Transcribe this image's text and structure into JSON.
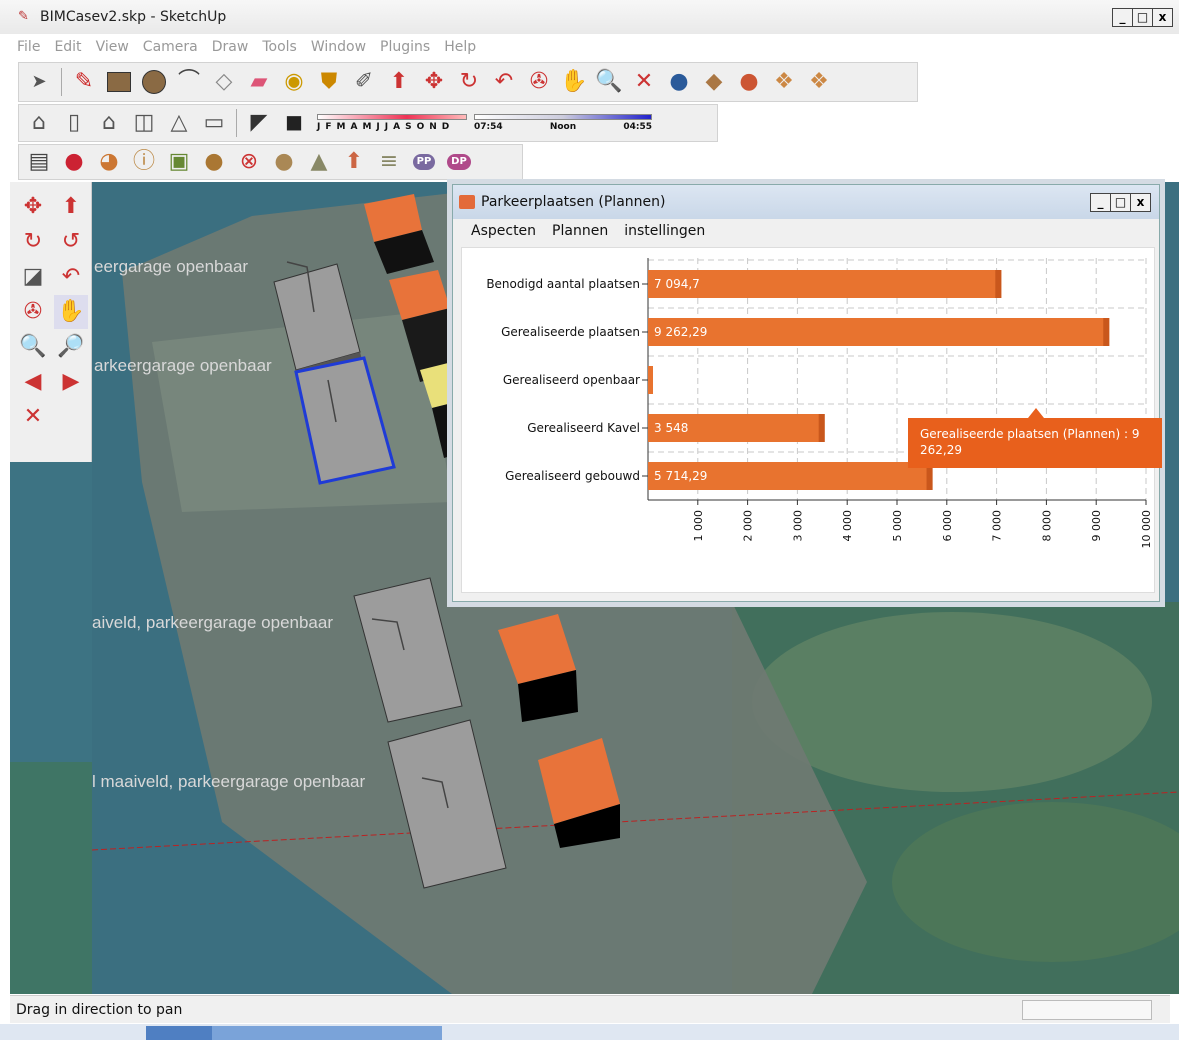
{
  "window": {
    "title": "BIMCasev2.skp - SketchUp",
    "controls": [
      "_",
      "□",
      "x"
    ]
  },
  "menubar": [
    "File",
    "Edit",
    "View",
    "Camera",
    "Draw",
    "Tools",
    "Window",
    "Plugins",
    "Help"
  ],
  "shadow_widget": {
    "months": [
      "J",
      "F",
      "M",
      "A",
      "M",
      "J",
      "J",
      "A",
      "S",
      "O",
      "N",
      "D"
    ],
    "time_start": "07:54",
    "time_mid": "Noon",
    "time_end": "04:55"
  },
  "viewport": {
    "labels": [
      "eergarage openbaar",
      "arkeergarage openbaar",
      "aiveld, parkeergarage openbaar",
      "l maaiveld, parkeergarage openbaar"
    ]
  },
  "dialog": {
    "title": "Parkeerplaatsen (Plannen)",
    "controls": [
      "_",
      "□",
      "x"
    ],
    "menus": [
      "Aspecten",
      "Plannen",
      "instellingen"
    ]
  },
  "chart_data": {
    "type": "bar",
    "orientation": "horizontal",
    "categories": [
      "Benodigd aantal plaatsen",
      "Gerealiseerde plaatsen",
      "Gerealiseerd openbaar",
      "Gerealiseerd Kavel",
      "Gerealiseerd gebouwd"
    ],
    "values": [
      7094.7,
      9262.29,
      0,
      3548,
      5714.29
    ],
    "value_labels": [
      "7 094,7",
      "9 262,29",
      "",
      "3 548",
      "5 714,29"
    ],
    "xlim": [
      0,
      10000
    ],
    "xticks": [
      1000,
      2000,
      3000,
      4000,
      5000,
      6000,
      7000,
      8000,
      9000,
      10000
    ],
    "xtick_labels": [
      "1 000",
      "2 000",
      "3 000",
      "4 000",
      "5 000",
      "6 000",
      "7 000",
      "8 000",
      "9 000",
      "10 000"
    ],
    "grid": true,
    "bar_color": "#e8732f",
    "tooltip": "Gerealiseerde plaatsen (Plannen) : 9 262,29"
  },
  "status": {
    "text": "Drag in direction to pan"
  },
  "colors": {
    "accent": "#e8732f",
    "tooltip": "#e8601c",
    "selection": "#1f3bd6"
  }
}
